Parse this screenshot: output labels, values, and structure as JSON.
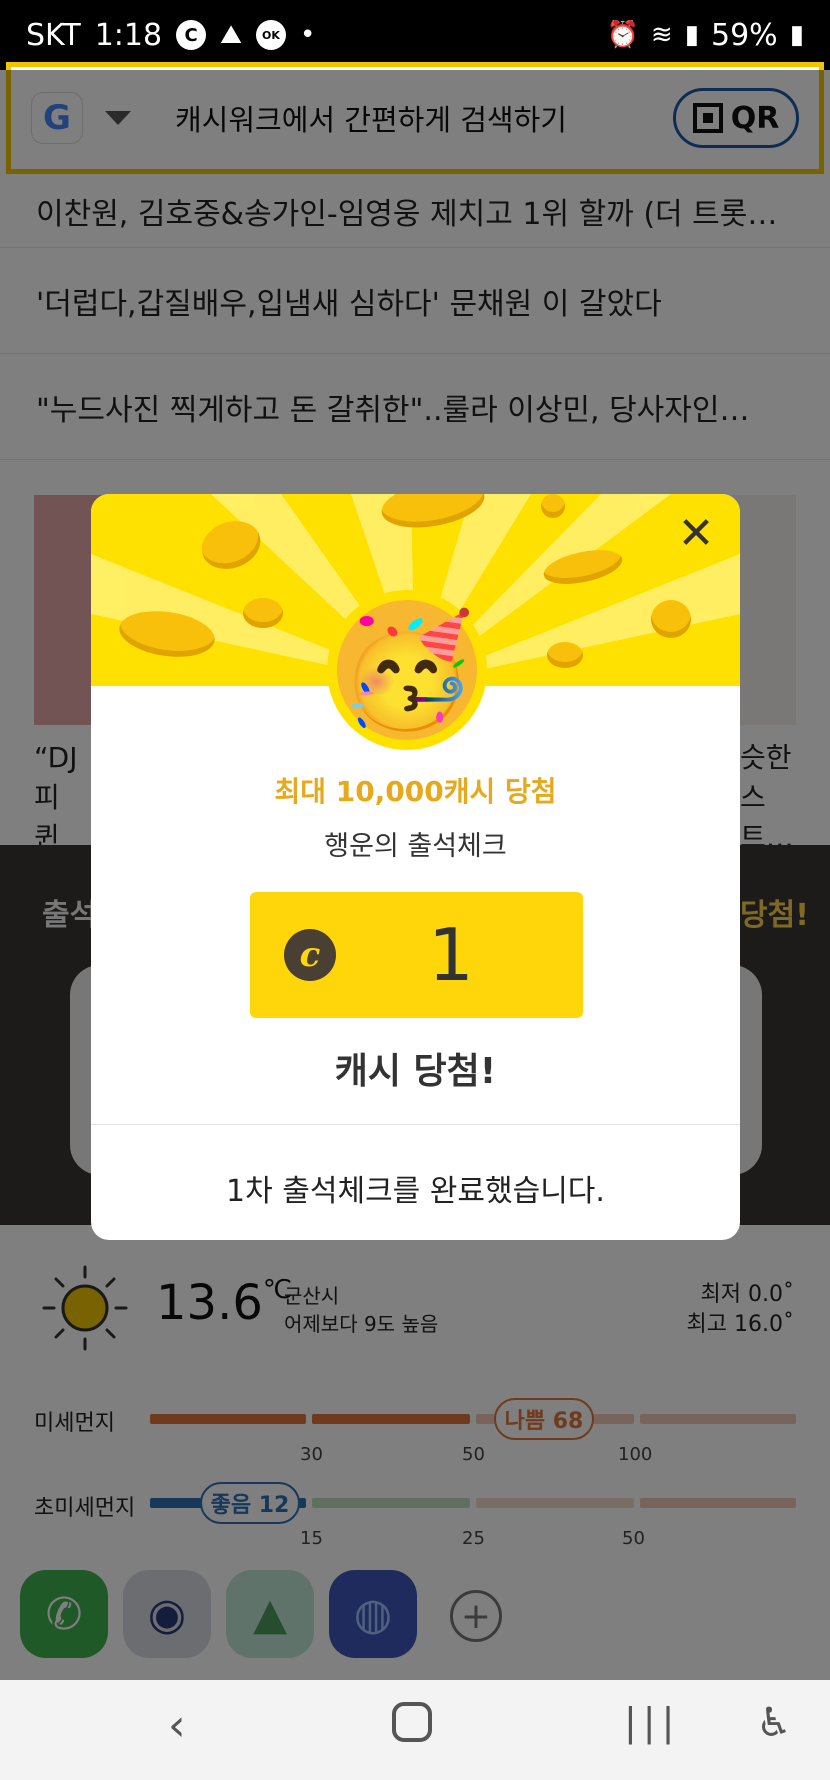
{
  "status": {
    "carrier": "SKT",
    "time": "1:18",
    "battery": "59%",
    "icons": [
      "c-icon",
      "app-icon",
      "oklock-icon",
      "dot-icon",
      "alarm-icon",
      "wifi-icon",
      "signal-icon",
      "battery-icon"
    ]
  },
  "search": {
    "placeholder": "캐시워크에서 간편하게 검색하기",
    "qr_label": "QR"
  },
  "news": [
    "이찬원, 김호중&송가인-임영웅 제치고 1위 할까 (더 트롯…",
    "'더럽다,갑질배우,입냄새 심하다' 문채원 이 갈았다",
    "\"누드사진 찍게하고 돈 갈취한\"..룰라 이상민, 당사자인…"
  ],
  "thumbs": {
    "left_caption": "“DJ피 퀸 와",
    "right_caption": "슷한 스트…"
  },
  "band": {
    "left": "출석",
    "right": "당첨!"
  },
  "weather": {
    "temp": "13.6",
    "unit": "℃",
    "city": "군산시",
    "compare": "어제보다 9도 높음",
    "min": "최저 0.0˚",
    "max": "최고 16.0˚"
  },
  "dust": {
    "pm10_label": "미세먼지",
    "pm10_badge": "나쁨 68",
    "pm10_ticks": [
      "30",
      "50",
      "100"
    ],
    "pm25_label": "초미세먼지",
    "pm25_badge": "좋음 12",
    "pm25_ticks": [
      "15",
      "25",
      "50"
    ]
  },
  "dock": {
    "apps": [
      "phone-icon",
      "camera-icon",
      "gallery-icon",
      "internet-icon"
    ],
    "add": "+"
  },
  "popup": {
    "prize_title": "최대 10,000캐시 당첨",
    "subtitle": "행운의 출석체크",
    "amount": "1",
    "coin_symbol": "c",
    "result": "캐시 당첨!",
    "footer": "1차 출석체크를 완료했습니다.",
    "close": "✕"
  },
  "colors": {
    "accent_yellow": "#ffe100",
    "prize_orange": "#e8a81c",
    "qr_border": "#1e5aa8",
    "bad_orange": "#e0773b",
    "good_blue": "#2f6fb6"
  }
}
